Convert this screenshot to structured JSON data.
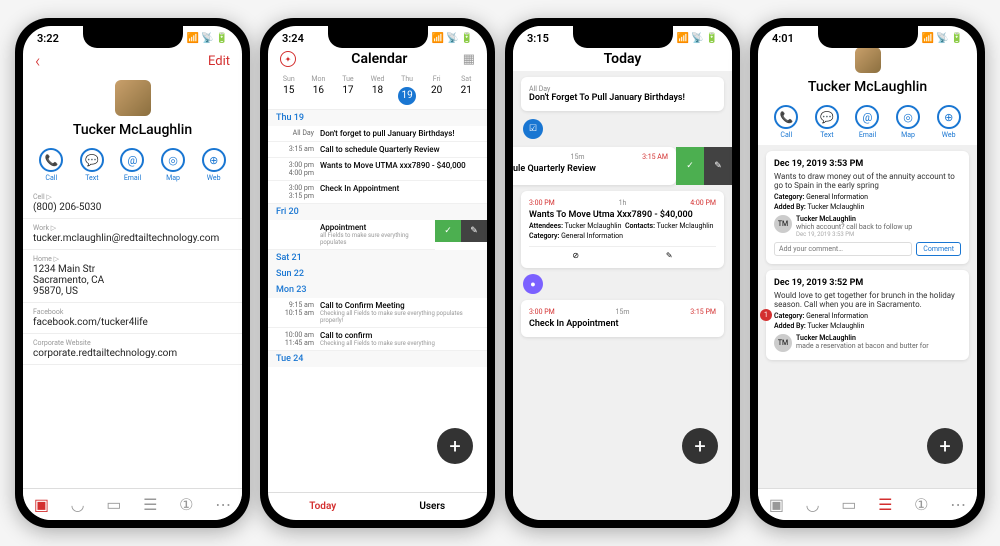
{
  "p1": {
    "time": "3:22",
    "back": "‹",
    "edit": "Edit",
    "name": "Tucker  McLaughlin",
    "actions": [
      {
        "icon": "📞",
        "label": "Call"
      },
      {
        "icon": "💬",
        "label": "Text"
      },
      {
        "icon": "@",
        "label": "Email"
      },
      {
        "icon": "◎",
        "label": "Map"
      },
      {
        "icon": "⊕",
        "label": "Web"
      }
    ],
    "fields": [
      {
        "label": "Cell  ▷",
        "value": "(800) 206-5030"
      },
      {
        "label": "Work  ▷",
        "value": "tucker.mclaughlin@redtailtechnology.com"
      },
      {
        "label": "Home  ▷",
        "value": "1234 Main Str\nSacramento, CA\n95870, US"
      },
      {
        "label": "Facebook",
        "value": "facebook.com/tucker4life"
      },
      {
        "label": "Corporate Website",
        "value": "corporate.redtailtechnology.com"
      }
    ]
  },
  "p2": {
    "time": "3:24",
    "title": "Calendar",
    "days": [
      "Sun",
      "Mon",
      "Tue",
      "Wed",
      "Thu",
      "Fri",
      "Sat"
    ],
    "nums": [
      "15",
      "16",
      "17",
      "18",
      "19",
      "20",
      "21"
    ],
    "today_idx": 4,
    "sections": [
      {
        "hdr": "Thu 19",
        "events": [
          {
            "time": "All Day",
            "title": "Don't forget to pull January Birthdays!"
          },
          {
            "time": "3:15 am",
            "title": "Call to schedule Quarterly Review"
          },
          {
            "time": "3:00 pm",
            "time2": "4:00 pm",
            "title": "Wants to Move UTMA xxx7890 - $40,000"
          },
          {
            "time": "3:00 pm",
            "time2": "3:15 pm",
            "title": "Check In Appointment"
          }
        ]
      },
      {
        "hdr": "Fri 20",
        "events": [
          {
            "time": "",
            "title": "Appointment",
            "sub": "all Fields to make sure everything populates",
            "swipe": true
          }
        ]
      },
      {
        "hdr": "Sat 21"
      },
      {
        "hdr": "Sun 22"
      },
      {
        "hdr": "Mon 23",
        "events": [
          {
            "time": "9:15 am",
            "time2": "10:15 am",
            "title": "Call to Confirm Meeting",
            "sub": "Checking all Fields to make sure everything populates properly!"
          },
          {
            "time": "10:00 am",
            "time2": "11:45 am",
            "title": "Call to confirm",
            "sub": "Checking all Fields to make sure everything"
          }
        ]
      },
      {
        "hdr": "Tue 24"
      }
    ],
    "tabs": [
      "Today",
      "Users"
    ]
  },
  "p3": {
    "time": "3:15",
    "title": "Today",
    "allday": "All Day",
    "banner": "Don't Forget To Pull January Birthdays!",
    "partial": {
      "dur": "15m",
      "end": "3:15 AM",
      "title": "ule Quarterly Review"
    },
    "card": {
      "start": "3:00 PM",
      "dur": "1h",
      "end": "4:00 PM",
      "title": "Wants To Move Utma Xxx7890 - $40,000",
      "attendees_lbl": "Attendees:",
      "attendees": "Tucker Mclaughlin",
      "contacts_lbl": "Contacts:",
      "contacts": "Tucker Mclaughlin",
      "category_lbl": "Category:",
      "category": "General Information"
    },
    "card2": {
      "start": "3:00 PM",
      "dur": "15m",
      "end": "3:15 PM",
      "title": "Check In Appointment"
    }
  },
  "p4": {
    "time": "4:01",
    "name": "Tucker  McLaughlin",
    "actions": [
      {
        "icon": "📞",
        "label": "Call"
      },
      {
        "icon": "💬",
        "label": "Text"
      },
      {
        "icon": "@",
        "label": "Email"
      },
      {
        "icon": "◎",
        "label": "Map"
      },
      {
        "icon": "⊕",
        "label": "Web"
      }
    ],
    "notes": [
      {
        "date": "Dec 19, 2019 3:53 PM",
        "body": "Wants to draw money out of the annuity account to go to Spain in the early spring",
        "category_lbl": "Category:",
        "category": "General Information",
        "added_lbl": "Added By:",
        "added": "Tucker Mclaughlin",
        "comment": {
          "av": "TM",
          "name": "Tucker McLaughlin",
          "body": "which account? call back to follow up",
          "date": "Dec 19, 2019 3:53 PM"
        },
        "placeholder": "Add your comment…",
        "btn": "Comment"
      },
      {
        "date": "Dec 19, 2019 3:52 PM",
        "body": "Would love to get together for brunch in the holiday season. Call when you are in Sacramento.",
        "category_lbl": "Category:",
        "category": "General Information",
        "added_lbl": "Added By:",
        "added": "Tucker Mclaughlin",
        "comment": {
          "av": "TM",
          "name": "Tucker McLaughlin",
          "body": "made a reservation at bacon and butter for"
        }
      }
    ],
    "badge": "1"
  }
}
